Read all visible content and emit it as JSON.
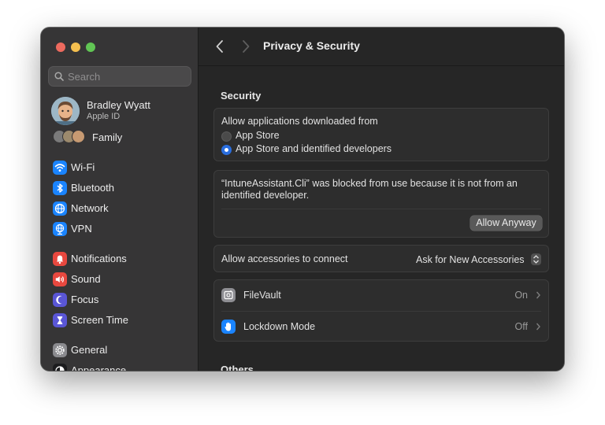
{
  "window": {
    "title": "Privacy & Security"
  },
  "search": {
    "placeholder": "Search"
  },
  "profile": {
    "name": "Bradley Wyatt",
    "subtitle": "Apple ID"
  },
  "family": {
    "label": "Family"
  },
  "sidebar": {
    "items": [
      {
        "label": "Wi-Fi",
        "icon": "wifi-icon",
        "color": "#1a84ff"
      },
      {
        "label": "Bluetooth",
        "icon": "bluetooth-icon",
        "color": "#1a84ff"
      },
      {
        "label": "Network",
        "icon": "globe-icon",
        "color": "#1a84ff"
      },
      {
        "label": "VPN",
        "icon": "vpn-globe-icon",
        "color": "#1a84ff"
      },
      {
        "label": "Notifications",
        "icon": "bell-icon",
        "color": "#e8483f"
      },
      {
        "label": "Sound",
        "icon": "speaker-icon",
        "color": "#e8483f"
      },
      {
        "label": "Focus",
        "icon": "moon-icon",
        "color": "#5a56d6"
      },
      {
        "label": "Screen Time",
        "icon": "hourglass-icon",
        "color": "#5a56d6"
      },
      {
        "label": "General",
        "icon": "gear-icon",
        "color": "#8a8a8e"
      },
      {
        "label": "Appearance",
        "icon": "appearance-icon",
        "color": "#1c1c1e"
      }
    ]
  },
  "security": {
    "heading": "Security",
    "allow_label": "Allow applications downloaded from",
    "options": [
      {
        "label": "App Store",
        "selected": false
      },
      {
        "label": "App Store and identified developers",
        "selected": true
      }
    ],
    "blocked_message": "“IntuneAssistant.Cli” was blocked from use because it is not from an identified developer.",
    "allow_anyway": "Allow Anyway",
    "accessories_label": "Allow accessories to connect",
    "accessories_value": "Ask for New Accessories",
    "filevault_label": "FileVault",
    "filevault_value": "On",
    "lockdown_label": "Lockdown Mode",
    "lockdown_value": "Off"
  },
  "others": {
    "heading": "Others"
  },
  "colors": {
    "accent": "#2a6ede",
    "filevault": "#8e8e93",
    "lockdown": "#1a84ff"
  }
}
